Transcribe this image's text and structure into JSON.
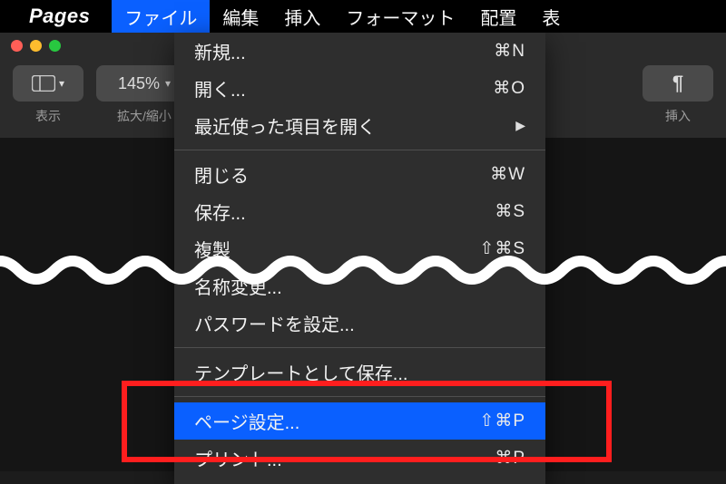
{
  "menubar": {
    "app": "Pages",
    "items": [
      "ファイル",
      "編集",
      "挿入",
      "フォーマット",
      "配置",
      "表"
    ],
    "active": 0
  },
  "toolbar": {
    "view": {
      "label": "表示"
    },
    "zoom": {
      "label": "拡大/縮小",
      "value": "145%"
    },
    "insert": {
      "label": "挿入"
    }
  },
  "file_menu": {
    "groups": [
      [
        {
          "label": "新規...",
          "shortcut": "⌘N"
        },
        {
          "label": "開く...",
          "shortcut": "⌘O"
        },
        {
          "label": "最近使った項目を開く",
          "submenu": true
        }
      ],
      [
        {
          "label": "閉じる",
          "shortcut": "⌘W"
        },
        {
          "label": "保存...",
          "shortcut": "⌘S"
        },
        {
          "label": "複製",
          "shortcut": "⇧⌘S"
        },
        {
          "label": "名称変更..."
        },
        {
          "label": "パスワードを設定..."
        }
      ],
      [
        {
          "label": "テンプレートとして保存..."
        }
      ],
      [
        {
          "label": "ページ設定...",
          "shortcut": "⇧⌘P",
          "selected": true
        },
        {
          "label": "プリント...",
          "shortcut": "⌘P"
        }
      ]
    ]
  }
}
